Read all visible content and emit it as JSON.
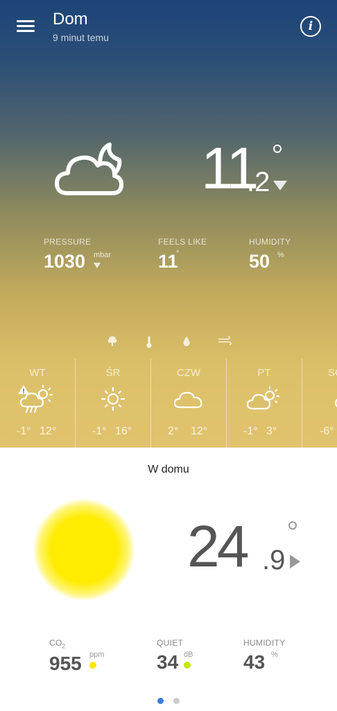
{
  "header": {
    "title": "Dom",
    "subtitle": "9 minut temu"
  },
  "outdoor": {
    "temp_int": "11",
    "temp_dec": ".2",
    "pressure": {
      "label": "PRESSURE",
      "value": "1030",
      "unit": "mbar"
    },
    "feels_like": {
      "label": "FEELS LIKE",
      "value": "11"
    },
    "humidity": {
      "label": "HUMIDITY",
      "value": "50",
      "unit": "%"
    }
  },
  "forecast": [
    {
      "day": "WT",
      "icon": "cloud-rain-sun-alert-icon",
      "low": "-1°",
      "high": "12°"
    },
    {
      "day": "ŚR",
      "icon": "sun-icon",
      "low": "-1°",
      "high": "16°"
    },
    {
      "day": "CZW",
      "icon": "cloud-icon",
      "low": "2°",
      "high": "12°"
    },
    {
      "day": "PT",
      "icon": "cloud-sun-icon",
      "low": "-1°",
      "high": "3°"
    },
    {
      "day": "SO",
      "icon": "cloud-icon",
      "low": "-6°",
      "high": ""
    }
  ],
  "indoor": {
    "title": "W domu",
    "temp_int": "24",
    "temp_dec": ".9",
    "co2": {
      "label": "CO",
      "label_sub": "2",
      "value": "955",
      "unit": "ppm",
      "status_color": "#ffe600"
    },
    "noise": {
      "label": "QUIET",
      "value": "34",
      "unit": "dB",
      "status_color": "#c8e600"
    },
    "humidity": {
      "label": "HUMIDITY",
      "value": "43",
      "unit": "%"
    }
  },
  "pager": {
    "active_color": "#3b7be0",
    "inactive_color": "#cccccc"
  }
}
